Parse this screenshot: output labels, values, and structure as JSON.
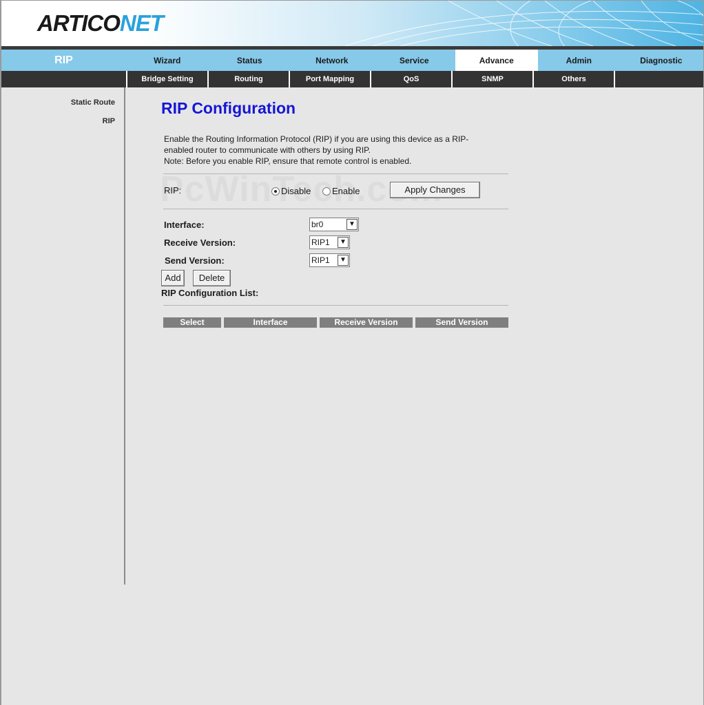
{
  "brand": {
    "part1": "ARTICO",
    "part2": "NET"
  },
  "section_title": "RIP",
  "main_nav": [
    {
      "label": "Wizard",
      "active": false
    },
    {
      "label": "Status",
      "active": false
    },
    {
      "label": "Network",
      "active": false
    },
    {
      "label": "Service",
      "active": false
    },
    {
      "label": "Advance",
      "active": true
    },
    {
      "label": "Admin",
      "active": false
    },
    {
      "label": "Diagnostic",
      "active": false
    }
  ],
  "sub_nav": [
    "Bridge Setting",
    "Routing",
    "Port Mapping",
    "QoS",
    "SNMP",
    "Others"
  ],
  "sidebar": {
    "items": [
      {
        "label": "Static Route"
      },
      {
        "label": "RIP"
      }
    ]
  },
  "page": {
    "title": "RIP Configuration",
    "description_line1": "Enable the Routing Information Protocol (RIP) if you are using this device as a RIP-",
    "description_line2": "enabled router to communicate with others by using RIP.",
    "description_line3": "Note: Before you enable RIP, ensure that remote control is enabled.",
    "watermark": "PcWinTech.com"
  },
  "rip": {
    "label": "RIP:",
    "disable_label": "Disable",
    "enable_label": "Enable",
    "selected": "Disable",
    "apply_label": "Apply Changes"
  },
  "form": {
    "interface_label": "Interface:",
    "interface_value": "br0",
    "receive_label": "Receive Version:",
    "receive_value": "RIP1",
    "send_label": "Send Version:",
    "send_value": "RIP1",
    "add_label": "Add",
    "delete_label": "Delete"
  },
  "list": {
    "title": "RIP Configuration List:",
    "columns": [
      "Select",
      "Interface",
      "Receive Version",
      "Send Version"
    ]
  },
  "colors": {
    "nav_bg": "#86c9e9",
    "subnav_bg": "#333333",
    "title": "#1515d6",
    "brand_accent": "#2aa2dc"
  }
}
